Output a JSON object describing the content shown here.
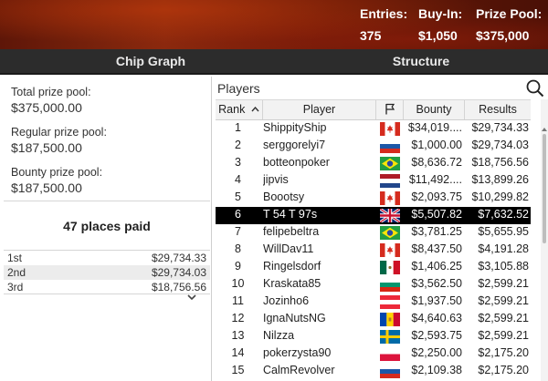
{
  "header": {
    "entries_label": "Entries:",
    "entries_value": "375",
    "buyin_label": "Buy-In:",
    "buyin_value": "$1,050",
    "prizepool_label": "Prize Pool:",
    "prizepool_value": "$375,000"
  },
  "tabs": {
    "chip_graph": "Chip Graph",
    "structure": "Structure"
  },
  "summary": {
    "total_label": "Total prize pool:",
    "total_value": "$375,000.00",
    "regular_label": "Regular prize pool:",
    "regular_value": "$187,500.00",
    "bounty_label": "Bounty prize pool:",
    "bounty_value": "$187,500.00",
    "places_paid": "47 places paid",
    "expand_icon": "chevron-down-icon"
  },
  "payouts": [
    {
      "place": "1st",
      "amount": "$29,734.33"
    },
    {
      "place": "2nd",
      "amount": "$29,734.03"
    },
    {
      "place": "3rd",
      "amount": "$18,756.56"
    }
  ],
  "players_panel": {
    "title": "Players",
    "search_icon": "search-icon",
    "columns": {
      "rank": "Rank",
      "player": "Player",
      "flag": "flag-icon",
      "bounty": "Bounty",
      "results": "Results"
    },
    "highlight_color": "#000000",
    "rows": [
      {
        "rank": "1",
        "player": "ShippityShip",
        "country": "ca",
        "bounty": "$34,019....",
        "results": "$29,734.33"
      },
      {
        "rank": "2",
        "player": "serggorelyi7",
        "country": "ru",
        "bounty": "$1,000.00",
        "results": "$29,734.03"
      },
      {
        "rank": "3",
        "player": "botteonpoker",
        "country": "br",
        "bounty": "$8,636.72",
        "results": "$18,756.56"
      },
      {
        "rank": "4",
        "player": "jipvis",
        "country": "nl",
        "bounty": "$11,492....",
        "results": "$13,899.26"
      },
      {
        "rank": "5",
        "player": "Boootsy",
        "country": "ca",
        "bounty": "$2,093.75",
        "results": "$10,299.82"
      },
      {
        "rank": "6",
        "player": "T 54 T 97s",
        "country": "gb",
        "bounty": "$5,507.82",
        "results": "$7,632.52",
        "highlighted": true
      },
      {
        "rank": "7",
        "player": "felipebeltra",
        "country": "br",
        "bounty": "$3,781.25",
        "results": "$5,655.95"
      },
      {
        "rank": "8",
        "player": "WillDav11",
        "country": "ca",
        "bounty": "$8,437.50",
        "results": "$4,191.28"
      },
      {
        "rank": "9",
        "player": "Ringelsdorf",
        "country": "mx",
        "bounty": "$1,406.25",
        "results": "$3,105.88"
      },
      {
        "rank": "10",
        "player": "Kraskata85",
        "country": "bg",
        "bounty": "$3,562.50",
        "results": "$2,599.21"
      },
      {
        "rank": "11",
        "player": "Jozinho6",
        "country": "at",
        "bounty": "$1,937.50",
        "results": "$2,599.21"
      },
      {
        "rank": "12",
        "player": "IgnaNutsNG",
        "country": "md",
        "bounty": "$4,640.63",
        "results": "$2,599.21"
      },
      {
        "rank": "13",
        "player": "Nilzza",
        "country": "se",
        "bounty": "$2,593.75",
        "results": "$2,599.21"
      },
      {
        "rank": "14",
        "player": "pokerzysta90",
        "country": "pl",
        "bounty": "$2,250.00",
        "results": "$2,175.20"
      },
      {
        "rank": "15",
        "player": "CalmRevolver",
        "country": "ru",
        "bounty": "$2,109.38",
        "results": "$2,175.20"
      }
    ]
  }
}
